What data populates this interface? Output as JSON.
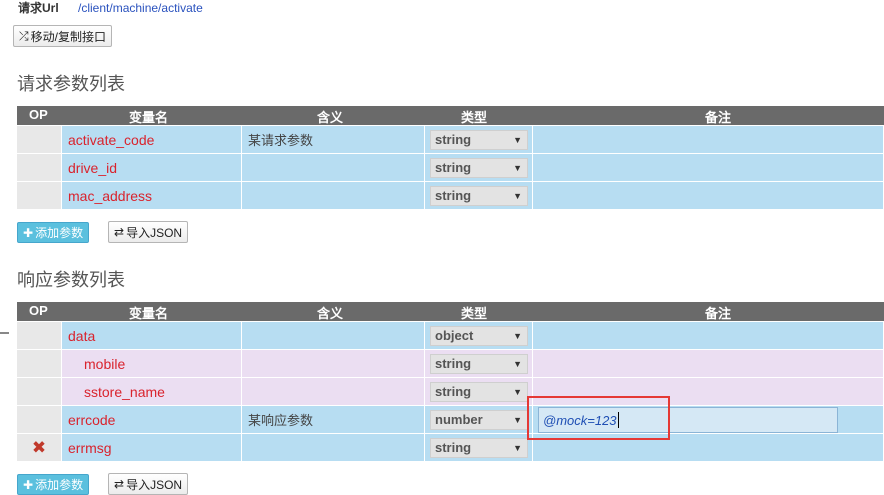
{
  "request_url": {
    "label": "请求Url",
    "value": "/client/machine/activate"
  },
  "move_copy_button": {
    "icon": "shuffle-icon",
    "label": "移动/复制接口"
  },
  "request_section": {
    "title": "请求参数列表",
    "columns": [
      "OP",
      "变量名",
      "含义",
      "类型",
      "备注"
    ],
    "rows": [
      {
        "name": "activate_code",
        "meaning": "某请求参数",
        "type": "string",
        "note": ""
      },
      {
        "name": "drive_id",
        "meaning": "",
        "type": "string",
        "note": ""
      },
      {
        "name": "mac_address",
        "meaning": "",
        "type": "string",
        "note": ""
      }
    ],
    "add_button": "添加参数",
    "import_button": "导入JSON"
  },
  "response_section": {
    "title": "响应参数列表",
    "columns": [
      "OP",
      "变量名",
      "含义",
      "类型",
      "备注"
    ],
    "rows": [
      {
        "name": "data",
        "meaning": "",
        "type": "object",
        "note": ""
      },
      {
        "name": "mobile",
        "meaning": "",
        "type": "string",
        "note": ""
      },
      {
        "name": "sstore_name",
        "meaning": "",
        "type": "string",
        "note": ""
      },
      {
        "name": "errcode",
        "meaning": "某响应参数",
        "type": "number",
        "note": "@mock=123"
      },
      {
        "name": "errmsg",
        "meaning": "",
        "type": "string",
        "note": "",
        "op": "✖"
      }
    ],
    "add_button": "添加参数",
    "import_button": "导入JSON"
  },
  "colors": {
    "row_blue": "#b7ddf2",
    "row_pink": "#ebdef2",
    "header": "#6a6a6a",
    "name_red": "#d9232d",
    "highlight": "#e53935"
  }
}
